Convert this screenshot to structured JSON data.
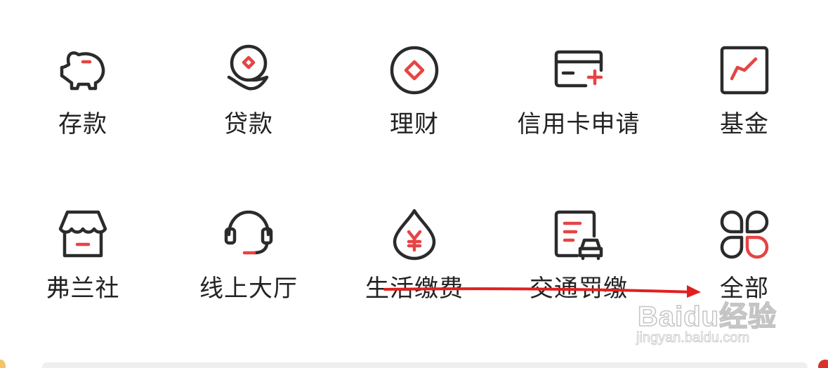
{
  "colors": {
    "icon_dark": "#2b2b2b",
    "icon_accent": "#e64444",
    "label_text": "#222222",
    "annotation_arrow": "#e02020"
  },
  "services": [
    {
      "label": "存款",
      "icon": "piggy-bank-icon"
    },
    {
      "label": "贷款",
      "icon": "loan-hand-coin-icon"
    },
    {
      "label": "理财",
      "icon": "wealth-coin-icon"
    },
    {
      "label": "信用卡申请",
      "icon": "credit-card-add-icon"
    },
    {
      "label": "基金",
      "icon": "fund-chart-icon"
    },
    {
      "label": "弗兰社",
      "icon": "store-icon"
    },
    {
      "label": "线上大厅",
      "icon": "headset-icon"
    },
    {
      "label": "生活缴费",
      "icon": "utility-drop-icon"
    },
    {
      "label": "交通罚缴",
      "icon": "traffic-fine-icon"
    },
    {
      "label": "全部",
      "icon": "all-services-icon"
    }
  ],
  "watermark": {
    "logo": "Baidu经验",
    "url": "jingyan.baidu.com"
  }
}
